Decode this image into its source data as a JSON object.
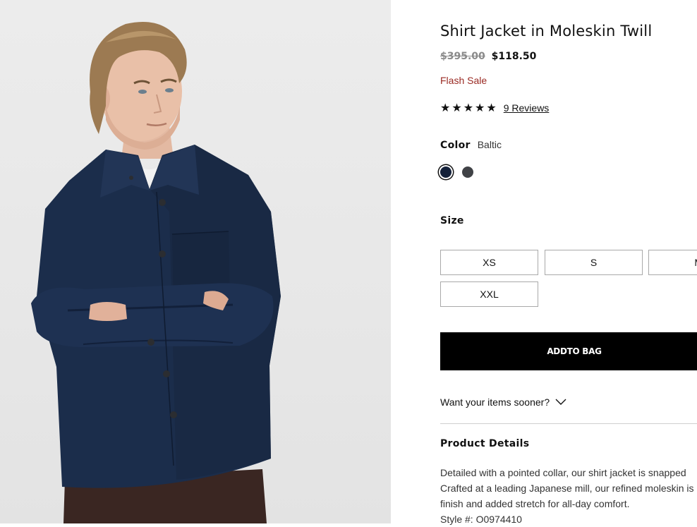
{
  "product": {
    "title": "Shirt Jacket in Moleskin Twill",
    "price_original": "$395.00",
    "price_sale": "$118.50",
    "sale_badge": "Flash Sale",
    "rating_stars": "★★★★★",
    "rating_value": 5,
    "reviews_link": "9 Reviews"
  },
  "color": {
    "label": "Color",
    "selected_name": "Baltic",
    "swatches": [
      {
        "name": "Baltic",
        "hex": "#14213a",
        "selected": true
      },
      {
        "name": "Charcoal",
        "hex": "#404246",
        "selected": false
      }
    ]
  },
  "size": {
    "label": "Size",
    "options": [
      "XS",
      "S",
      "M",
      "XXL"
    ]
  },
  "cart": {
    "add_to_bag_label": "ADDTO BAG"
  },
  "delivery": {
    "prompt": "Want your items sooner?",
    "icon": "chevron-down-icon"
  },
  "details": {
    "title": "Product Details",
    "lines": [
      "Detailed with a pointed collar, our shirt jacket is snapped",
      "Crafted at a leading Japanese mill, our refined moleskin is",
      "finish and added stretch for all-day comfort.",
      "Style #: O0974410"
    ]
  },
  "colors": {
    "sale_red": "#9a2a23",
    "button_black": "#000000",
    "jacket_navy": "#1b2d4b"
  }
}
